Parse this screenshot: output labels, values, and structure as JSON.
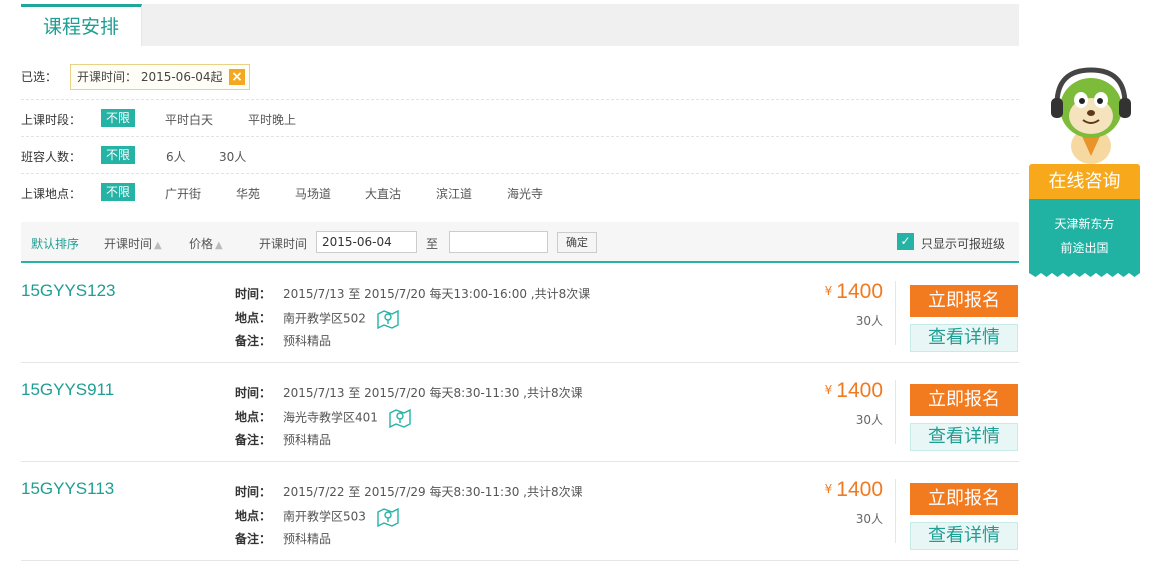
{
  "tab": {
    "title": "课程安排"
  },
  "filters": {
    "chosen_label": "已选：",
    "chosen_tag": "开课时间： 2015-06-04起",
    "rows": [
      {
        "label": "上课时段：",
        "options": [
          "不限",
          "平时白天",
          "平时晚上"
        ]
      },
      {
        "label": "班容人数：",
        "options": [
          "不限",
          "6人",
          "30人"
        ]
      },
      {
        "label": "上课地点：",
        "options": [
          "不限",
          "广开街",
          "华苑",
          "马场道",
          "大直沽",
          "滨江道",
          "海光寺"
        ]
      }
    ]
  },
  "sortbar": {
    "default_sort": "默认排序",
    "start_time_sort": "开课时间",
    "price_sort": "价格",
    "date_label": "开课时间",
    "date_from": "2015-06-04",
    "date_to": "",
    "to_label": "至",
    "confirm": "确定",
    "only_open_label": "只显示可报班级"
  },
  "courses": [
    {
      "code": "15GYYS123",
      "time_label": "时间：",
      "time": "2015/7/13 至 2015/7/20 每天13:00-16:00 ,共计8次课",
      "place_label": "地点：",
      "place": "南开教学区502",
      "note_label": "备注：",
      "note": "预科精品",
      "currency": "¥",
      "price": "1400",
      "seats": "30人",
      "enroll": "立即报名",
      "detail": "查看详情"
    },
    {
      "code": "15GYYS911",
      "time_label": "时间：",
      "time": "2015/7/13 至 2015/7/20 每天8:30-11:30 ,共计8次课",
      "place_label": "地点：",
      "place": "海光寺教学区401",
      "note_label": "备注：",
      "note": "预科精品",
      "currency": "¥",
      "price": "1400",
      "seats": "30人",
      "enroll": "立即报名",
      "detail": "查看详情"
    },
    {
      "code": "15GYYS113",
      "time_label": "时间：",
      "time": "2015/7/22 至 2015/7/29 每天8:30-11:30 ,共计8次课",
      "place_label": "地点：",
      "place": "南开教学区503",
      "note_label": "备注：",
      "note": "预科精品",
      "currency": "¥",
      "price": "1400",
      "seats": "30人",
      "enroll": "立即报名",
      "detail": "查看详情"
    }
  ],
  "consult": {
    "title": "在线咨询",
    "line1": "天津新东方",
    "line2": "前途出国"
  },
  "colors": {
    "accent": "#24b3a5",
    "price": "#f07a22",
    "enroll_bg": "#f27a1f",
    "consult_head": "#f7a81b"
  },
  "icons": [
    "close-icon",
    "sort-arrow-icon",
    "checkbox-checked-icon",
    "map-pin-icon",
    "mascot-image"
  ]
}
